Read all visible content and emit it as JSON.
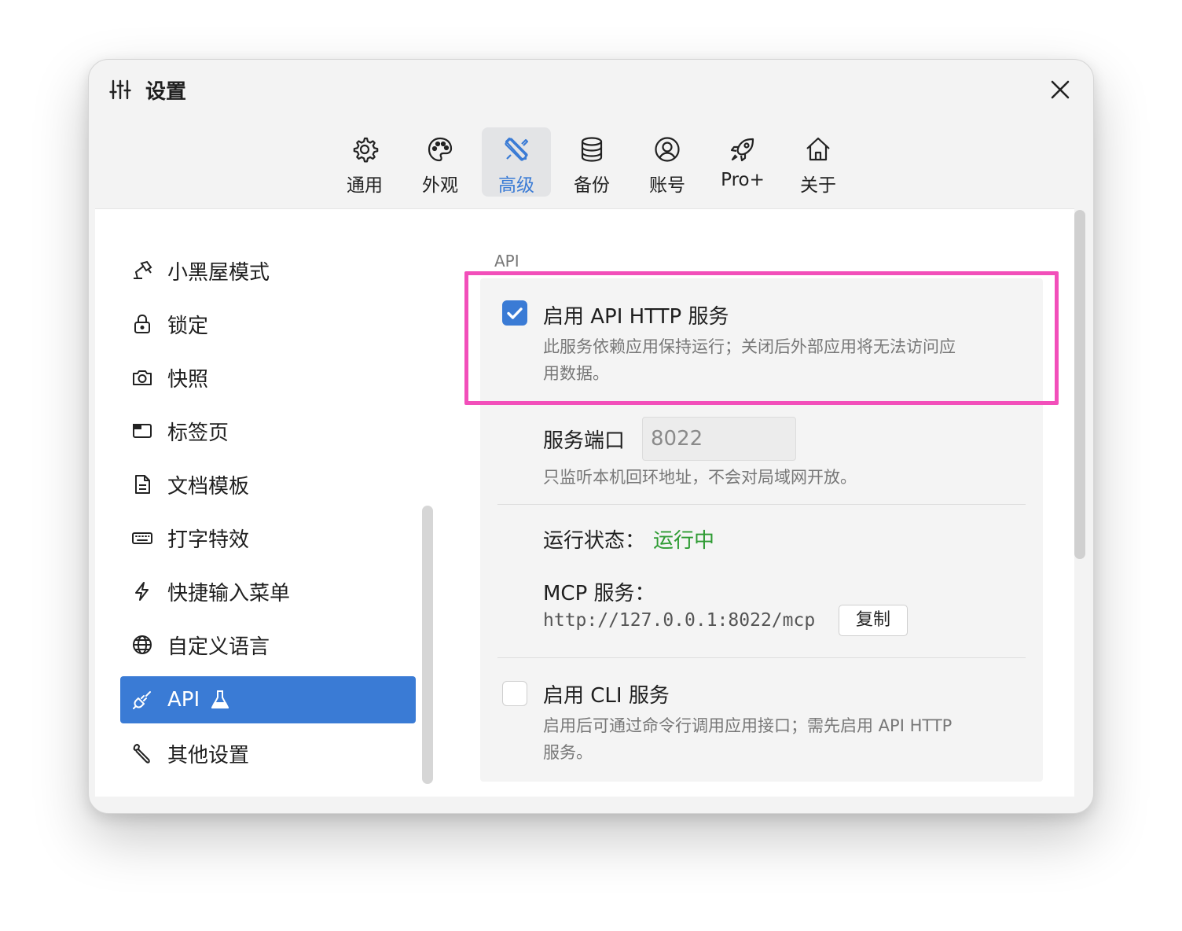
{
  "window": {
    "title": "设置"
  },
  "tabs": [
    {
      "label": "通用",
      "icon": "gear-icon"
    },
    {
      "label": "外观",
      "icon": "palette-icon"
    },
    {
      "label": "高级",
      "icon": "tools-icon",
      "active": true
    },
    {
      "label": "备份",
      "icon": "database-icon"
    },
    {
      "label": "账号",
      "icon": "user-icon"
    },
    {
      "label": "Pro+",
      "icon": "rocket-icon"
    },
    {
      "label": "关于",
      "icon": "home-icon"
    }
  ],
  "sidebar": {
    "items": [
      {
        "label": "小黑屋模式",
        "icon": "lamp-icon"
      },
      {
        "label": "锁定",
        "icon": "lock-icon"
      },
      {
        "label": "快照",
        "icon": "camera-icon"
      },
      {
        "label": "标签页",
        "icon": "tab-icon"
      },
      {
        "label": "文档模板",
        "icon": "document-icon"
      },
      {
        "label": "打字特效",
        "icon": "keyboard-icon"
      },
      {
        "label": "快捷输入菜单",
        "icon": "lightning-icon"
      },
      {
        "label": "自定义语言",
        "icon": "globe-icon"
      },
      {
        "label": "API",
        "icon": "plug-icon",
        "active": true,
        "badge_icon": "flask-icon"
      },
      {
        "label": "其他设置",
        "icon": "wrench-icon"
      }
    ]
  },
  "panel": {
    "heading": "API",
    "api_http": {
      "checked": true,
      "title": "启用 API HTTP 服务",
      "desc_line1": "此服务依赖应用保持运行；关闭后外部应用将无法访问应",
      "desc_line2": "用数据。"
    },
    "port": {
      "label": "服务端口",
      "value": "8022",
      "hint": "只监听本机回环地址，不会对局域网开放。"
    },
    "status": {
      "label": "运行状态：",
      "value": "运行中"
    },
    "mcp": {
      "label": "MCP 服务：",
      "url": "http://127.0.0.1:8022/mcp",
      "copy_label": "复制"
    },
    "cli": {
      "checked": false,
      "title": "启用 CLI 服务",
      "desc_line1": "启用后可通过命令行调用应用接口；需先启用 API HTTP",
      "desc_line2": "服务。"
    }
  },
  "colors": {
    "accent": "#3a7bd5",
    "highlight": "#f24fba",
    "running": "#2e9b33"
  }
}
